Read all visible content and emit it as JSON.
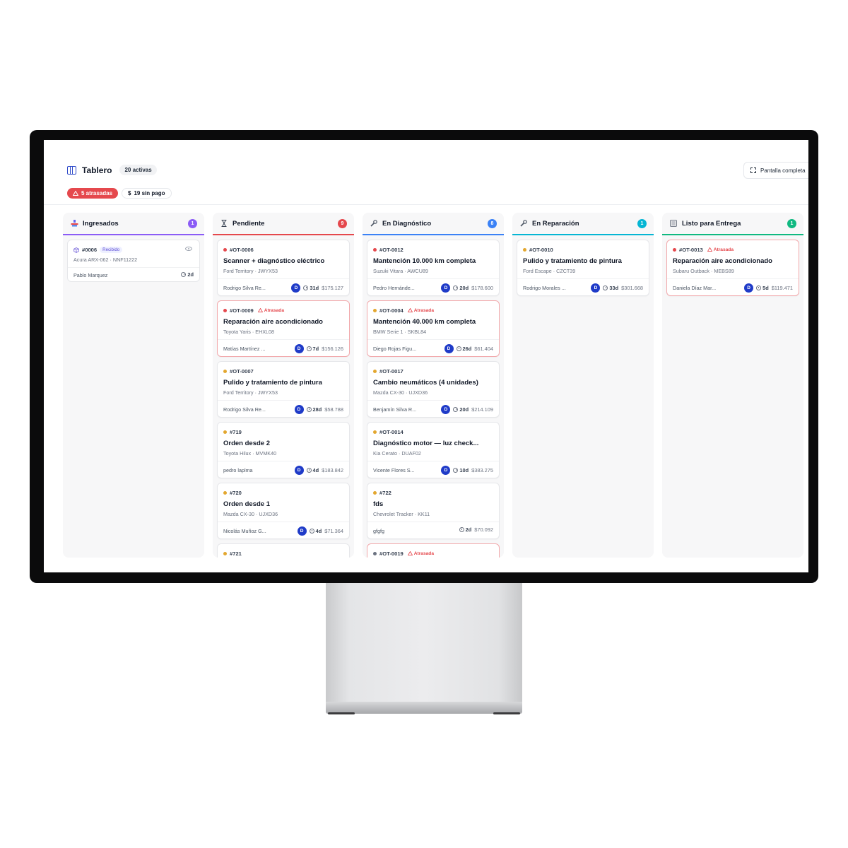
{
  "header": {
    "title": "Tablero",
    "active_count": "20 activas",
    "fullscreen_label": "Pantalla completa",
    "late_badge": "5 atrasadas",
    "unpaid_badge": "19 sin pago"
  },
  "colors": {
    "late": "#e5484d",
    "avatar": "#1f3bc8",
    "yellow": "#e3a72f",
    "gray": "#6b7280"
  },
  "columns": [
    {
      "title": "Ingresados",
      "count": "1",
      "accent": "#8b5cf6",
      "icon": "inbox-icon"
    },
    {
      "title": "Pendiente",
      "count": "9",
      "accent": "#e5484d",
      "icon": "hourglass-icon"
    },
    {
      "title": "En Diagnóstico",
      "count": "8",
      "accent": "#3b82f6",
      "icon": "wrench-icon"
    },
    {
      "title": "En Reparación",
      "count": "1",
      "accent": "#06b6d4",
      "icon": "wrench-icon"
    },
    {
      "title": "Listo para Entrega",
      "count": "1",
      "accent": "#10b981",
      "icon": "checklist-icon"
    }
  ],
  "ingresados": [
    {
      "id": "#0006",
      "status": "Recibido",
      "vehicle": "Acura ARX-062 · NNF11222",
      "person": "Pablo Marquez",
      "days": "2d"
    }
  ],
  "pendiente": [
    {
      "id": "#OT-0006",
      "title": "Scanner + diagnóstico eléctrico",
      "vehicle": "Ford Territory · JWYX53",
      "person": "Rodrigo Silva Re...",
      "avatar": "D",
      "days": "31d",
      "amount": "$175.127",
      "dot": "red",
      "late": false
    },
    {
      "id": "#OT-0009",
      "title": "Reparación aire acondicionado",
      "vehicle": "Toyota Yaris · EHXL08",
      "person": "Matías Martínez ...",
      "avatar": "D",
      "days": "7d",
      "amount": "$156.126",
      "dot": "red",
      "late": true,
      "late_label": "Atrasada"
    },
    {
      "id": "#OT-0007",
      "title": "Pulido y tratamiento de pintura",
      "vehicle": "Ford Territory · JWYX53",
      "person": "Rodrigo Silva Re...",
      "avatar": "D",
      "days": "28d",
      "amount": "$58.788",
      "dot": "yellow",
      "late": false
    },
    {
      "id": "#719",
      "title": "Orden desde 2",
      "vehicle": "Toyota Hilux · MVMK40",
      "person": "pedro laplma",
      "avatar": "D",
      "days": "4d",
      "amount": "$183.842",
      "dot": "yellow",
      "late": false
    },
    {
      "id": "#720",
      "title": "Orden desde 1",
      "vehicle": "Mazda CX-30 · UJXD36",
      "person": "Nicolás Muñoz G...",
      "avatar": "D",
      "days": "4d",
      "amount": "$71.364",
      "dot": "yellow",
      "late": false
    },
    {
      "id": "#721",
      "dot": "yellow"
    }
  ],
  "diagnostico": [
    {
      "id": "#OT-0012",
      "title": "Mantención 10.000 km completa",
      "vehicle": "Suzuki Vitara · AWCU89",
      "person": "Pedro Hernánde...",
      "avatar": "D",
      "days": "20d",
      "amount": "$178.600",
      "dot": "red",
      "late": false
    },
    {
      "id": "#OT-0004",
      "title": "Mantención 40.000 km completa",
      "vehicle": "BMW Serie 1 · SKBL84",
      "person": "Diego Rojas Figu...",
      "avatar": "D",
      "days": "26d",
      "amount": "$61.404",
      "dot": "yellow",
      "late": true,
      "late_label": "Atrasada"
    },
    {
      "id": "#OT-0017",
      "title": "Cambio neumáticos (4 unidades)",
      "vehicle": "Mazda CX-30 · UJXD36",
      "person": "Benjamín Silva R...",
      "avatar": "D",
      "days": "20d",
      "amount": "$214.109",
      "dot": "yellow",
      "late": false
    },
    {
      "id": "#OT-0014",
      "title": "Diagnóstico motor — luz check...",
      "vehicle": "Kia Cerato · DUAF02",
      "person": "Vicente Flores S...",
      "avatar": "D",
      "days": "10d",
      "amount": "$383.275",
      "dot": "yellow",
      "late": false
    },
    {
      "id": "#722",
      "title": "fds",
      "vehicle": "Chevrolet Tracker · KK11",
      "person": "gfgfg",
      "avatar": "",
      "days": "2d",
      "amount": "$70.092",
      "dot": "yellow",
      "late": false
    },
    {
      "id": "#OT-0019",
      "dot": "gray",
      "late": true,
      "late_label": "Atrasada"
    }
  ],
  "reparacion": [
    {
      "id": "#OT-0010",
      "title": "Pulido y tratamiento de pintura",
      "vehicle": "Ford Escape · CZCT39",
      "person": "Rodrigo Morales ...",
      "avatar": "D",
      "days": "33d",
      "amount": "$301.668",
      "dot": "yellow",
      "late": false
    }
  ],
  "listo": [
    {
      "id": "#OT-0013",
      "title": "Reparación aire acondicionado",
      "vehicle": "Subaru Outback · MEBS89",
      "person": "Daniela Díaz Mar...",
      "avatar": "D",
      "days": "5d",
      "amount": "$119.471",
      "dot": "red",
      "late": true,
      "late_label": "Atrasada"
    }
  ]
}
